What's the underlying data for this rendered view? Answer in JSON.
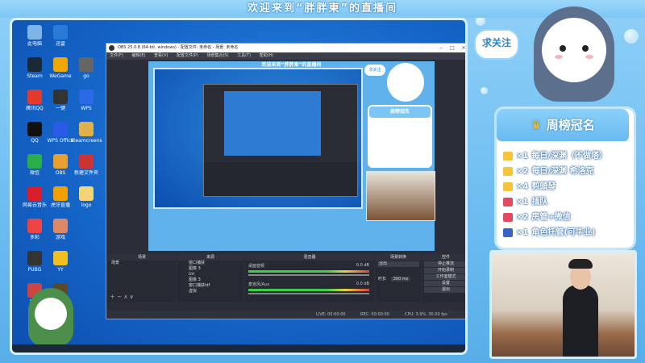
{
  "banner": {
    "title": "欢迎来到“胖胖東”的直播间"
  },
  "follow_badge": {
    "label": "求关注"
  },
  "weekly": {
    "title": "周榜冠名",
    "gifts": [
      {
        "count": "×1",
        "name": "每日/深渊（不做塔）",
        "color": "#f5c43a"
      },
      {
        "count": "×2",
        "name": "每日/深渊 希洛克",
        "color": "#f5c43a"
      },
      {
        "count": "×4",
        "name": "剪頭發",
        "color": "#f5c43a"
      },
      {
        "count": "×1",
        "name": "插队",
        "color": "#e24b5f"
      },
      {
        "count": "×2",
        "name": "房管+微信",
        "color": "#e24b5f"
      },
      {
        "count": "×1",
        "name": "角色托管(可毕业)",
        "color": "#3a63c8"
      }
    ]
  },
  "desktop": {
    "icons": [
      {
        "label": "此电脑",
        "color": "#7fb4e8"
      },
      {
        "label": "迅雷",
        "color": "#2a7ad8"
      },
      {
        "label": "Steam",
        "color": "#1b2838"
      },
      {
        "label": "WeGame",
        "color": "#f0a800"
      },
      {
        "label": "go",
        "color": "#666"
      },
      {
        "label": "腾讯QQ",
        "color": "#e43a2d"
      },
      {
        "label": "一键",
        "color": "#333"
      },
      {
        "label": "WPS",
        "color": "#2a6ae8"
      },
      {
        "label": "QQ",
        "color": "#111"
      },
      {
        "label": "WPS Office",
        "color": "#2a5be6"
      },
      {
        "label": "Steamcreens",
        "color": "#e0b04a"
      },
      {
        "label": "微信",
        "color": "#2aae4a"
      },
      {
        "label": "OBS",
        "color": "#e8a030"
      },
      {
        "label": "新建文件夹",
        "color": "#c33"
      },
      {
        "label": "网易云音乐",
        "color": "#d81e2a"
      },
      {
        "label": "虎牙直播",
        "color": "#f0a000"
      },
      {
        "label": "logo",
        "color": "#f3d477"
      },
      {
        "label": "多彩",
        "color": "#e44"
      },
      {
        "label": "游戏",
        "color": "#d86"
      },
      {
        "label": "PUBG",
        "color": "#333"
      },
      {
        "label": "YY",
        "color": "#f0c020"
      },
      {
        "label": "图片",
        "color": "#c44"
      },
      {
        "label": "PUBG",
        "color": "#5a4a2a"
      }
    ]
  },
  "obs": {
    "title": "OBS 25.0.8 (64-bit, windows) - 配置文件: 未命名 - 场景: 未命名",
    "menu": [
      "文件(F)",
      "编辑(E)",
      "查看(V)",
      "配置文件(P)",
      "场景集合(S)",
      "工具(T)",
      "帮助(H)"
    ],
    "docks": {
      "scenes": "场景",
      "sources": "来源",
      "mixer": "混音器",
      "transitions": "场景转换",
      "controls": "控件"
    },
    "scene_items": [
      "场景"
    ],
    "source_items": [
      "窗口捕获",
      "图像 3",
      "Url",
      "图像 3",
      "窗口捕获ldf",
      "虚拟"
    ],
    "mixer_tracks": [
      {
        "name": "桌面音频",
        "level": "0.0 dB"
      },
      {
        "name": "麦克风/Aux",
        "level": "0.0 dB"
      }
    ],
    "transition": {
      "type": "淡出",
      "duration_label": "时长",
      "duration": "300 ms"
    },
    "control_buttons": [
      "停止推流",
      "开始录制",
      "工作室模式",
      "设置",
      "退出"
    ],
    "status": {
      "live": "LIVE: 00:00:00",
      "rec": "REC: 00:00:00",
      "cpu": "CPU: 3.9%, 30.00 fps"
    }
  },
  "preview": {
    "banner": "欢迎来到“胖胖東”的直播间",
    "follow": "求关注",
    "weekly_title": "周榜冠名"
  }
}
